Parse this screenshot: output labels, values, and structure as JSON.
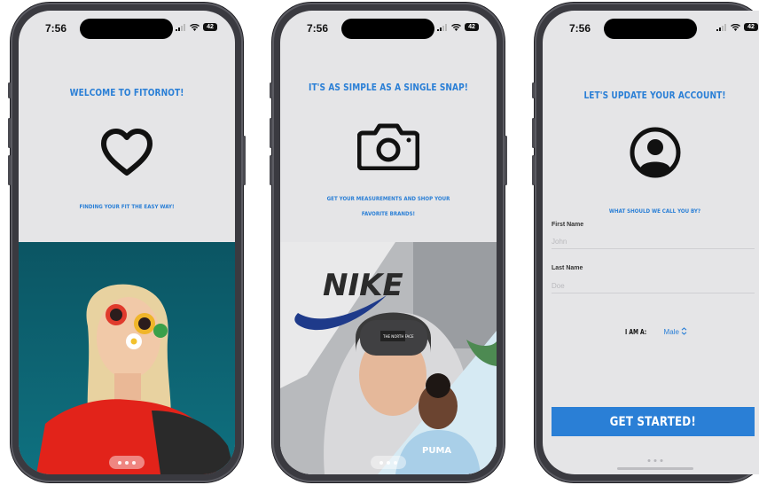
{
  "status": {
    "time": "7:56",
    "battery": "42"
  },
  "screens": [
    {
      "headline": "WELCOME TO FITORNOT!",
      "icon": "heart-icon",
      "tagline": "FINDING YOUR FIT THE EASY WAY!"
    },
    {
      "headline": "IT'S AS SIMPLE AS A SINGLE SNAP!",
      "icon": "camera-icon",
      "tagline_line1": "GET YOUR MEASUREMENTS AND SHOP YOUR",
      "tagline_line2": "FAVORITE BRANDS!",
      "brands": {
        "nike": "NIKE",
        "northface": "THE NORTH FACE",
        "puma": "PUMA"
      }
    },
    {
      "headline": "LET'S UPDATE YOUR ACCOUNT!",
      "icon": "user-avatar-icon",
      "tagline": "WHAT SHOULD WE CALL YOU BY?",
      "first_name_label": "First Name",
      "first_name_placeholder": "John",
      "last_name_label": "Last Name",
      "last_name_placeholder": "Doe",
      "gender_label": "I AM A:",
      "gender_value": "Male",
      "gender_chevron": "⌃⌄",
      "cta_label": "GET STARTED!"
    }
  ],
  "colors": {
    "accent": "#2a7fd6",
    "screen_bg": "#e5e5e7",
    "frame": "#3a3a40"
  }
}
